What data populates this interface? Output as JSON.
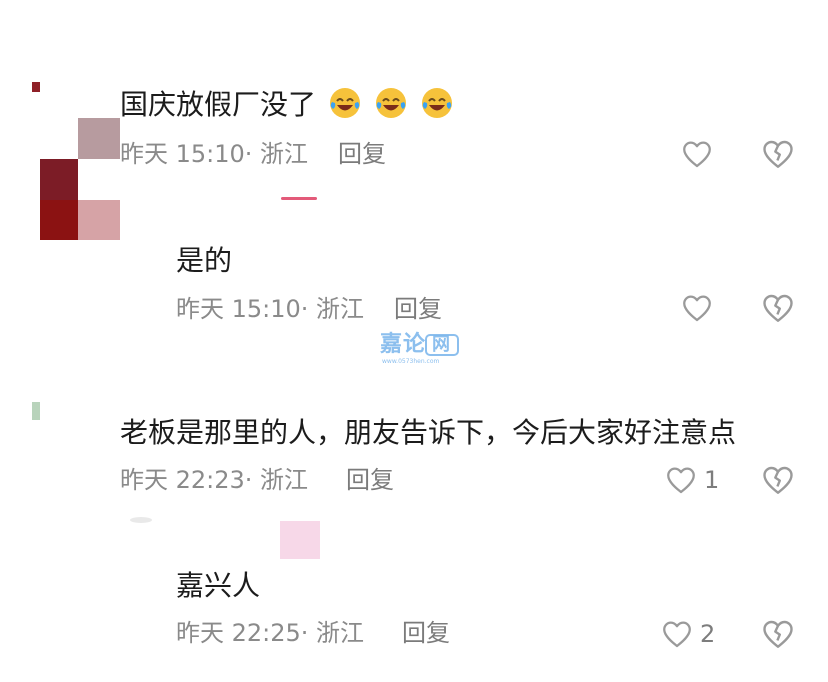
{
  "comments": [
    {
      "id": "c1",
      "text": "国庆放假厂没了",
      "emoji_count": 3,
      "meta": "昨天 15:10· 浙江",
      "reply_label": "回复",
      "like_count": ""
    },
    {
      "id": "c2",
      "text": "是的",
      "meta": "昨天 15:10· 浙江",
      "reply_label": "回复",
      "like_count": ""
    },
    {
      "id": "c3",
      "text": "老板是那里的人，朋友告诉下，今后大家好注意点",
      "meta": "昨天 22:23· 浙江",
      "reply_label": "回复",
      "like_count": "1"
    },
    {
      "id": "c4",
      "text": "嘉兴人",
      "meta": "昨天 22:25· 浙江",
      "reply_label": "回复",
      "like_count": "2"
    }
  ],
  "watermark": {
    "main": "嘉论",
    "box_text": "网",
    "sub": "www.0573hen.com"
  },
  "colors": {
    "text": "#1c1c1c",
    "meta": "#8a8a8a",
    "icon": "#9a9a9a",
    "watermark": "#78b4eb",
    "accent_pink": "#e35a79",
    "avatar_dark": "#7c1c26",
    "avatar_red": "#8b1212",
    "avatar_mauve": "#b79b9f",
    "avatar_pink": "#d6a3a6",
    "avatar_light_pink": "#f7d8e8"
  },
  "icons": {
    "like": "heart-outline-icon",
    "dislike": "broken-heart-icon",
    "emoji": "laughing-tears-icon"
  }
}
